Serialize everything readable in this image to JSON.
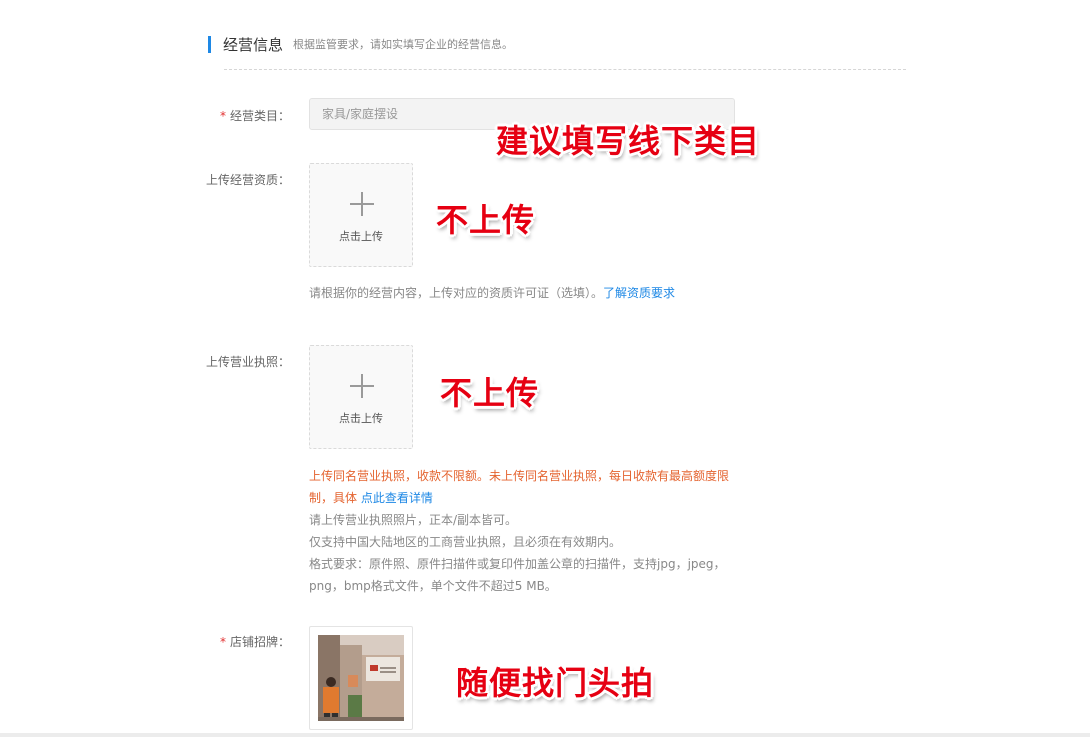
{
  "section": {
    "title": "经营信息",
    "description": "根据监管要求，请如实填写企业的经营信息。"
  },
  "business_category": {
    "required_mark": "*",
    "label": "经营类目：",
    "value": "家具/家庭摆设"
  },
  "qualification": {
    "label": "上传经营资质：",
    "upload_text": "点击上传",
    "hint": "请根据你的经营内容，上传对应的资质许可证（选填）。",
    "hint_link": "了解资质要求"
  },
  "license": {
    "label": "上传营业执照：",
    "upload_text": "点击上传",
    "warning_line1": "上传同名营业执照，收款不限额。未上传同名营业执照，每日收款有最高额度限",
    "warning_line2": "制，具体",
    "warning_link": "点此查看详情",
    "hint_line1": "请上传营业执照照片，正本/副本皆可。",
    "hint_line2": "仅支持中国大陆地区的工商营业执照，且必须在有效期内。",
    "hint_line3": "格式要求：原件照、原件扫描件或复印件加盖公章的扫描件，支持jpg，jpeg，",
    "hint_line4": "png，bmp格式文件，单个文件不超过5 MB。"
  },
  "storefront": {
    "required_mark": "*",
    "label": "店铺招牌："
  },
  "annotations": {
    "category_note": "建议填写线下类目",
    "qualification_note": "不上传",
    "license_note": "不上传",
    "storefront_note": "随便找门头拍"
  },
  "colors": {
    "accent": "#1e88e5",
    "required": "#e23131",
    "warning": "#e4632f",
    "annotation": "#e60012"
  }
}
